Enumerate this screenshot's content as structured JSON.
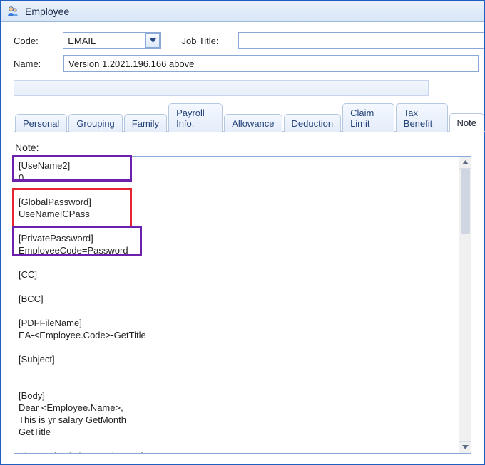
{
  "window": {
    "title": "Employee"
  },
  "form": {
    "code_label": "Code:",
    "code_value": "EMAIL",
    "jobtitle_label": "Job Title:",
    "jobtitle_value": "",
    "name_label": "Name:",
    "name_value": "Version 1.2021.196.166   above"
  },
  "tabs": {
    "items": [
      "Personal",
      "Grouping",
      "Family",
      "Payroll Info.",
      "Allowance",
      "Deduction",
      "Claim Limit",
      "Tax Benefit",
      "Note"
    ],
    "active_index": 8
  },
  "note": {
    "label": "Note:",
    "content": "[UseName2]\n0\n\n[GlobalPassword]\nUseNameICPass\n\n[PrivatePassword]\nEmployeeCode=Password\n\n[CC]\n\n[BCC]\n\n[PDFFileName]\nEA-<Employee.Code>-GetTitle\n\n[Subject]\n\n\n[Body]\nDear <Employee.Name>,\nThis is yr salary GetMonth\nGetTitle\n\nPlease check the attachment for ...\n\nBest Regards,"
  }
}
